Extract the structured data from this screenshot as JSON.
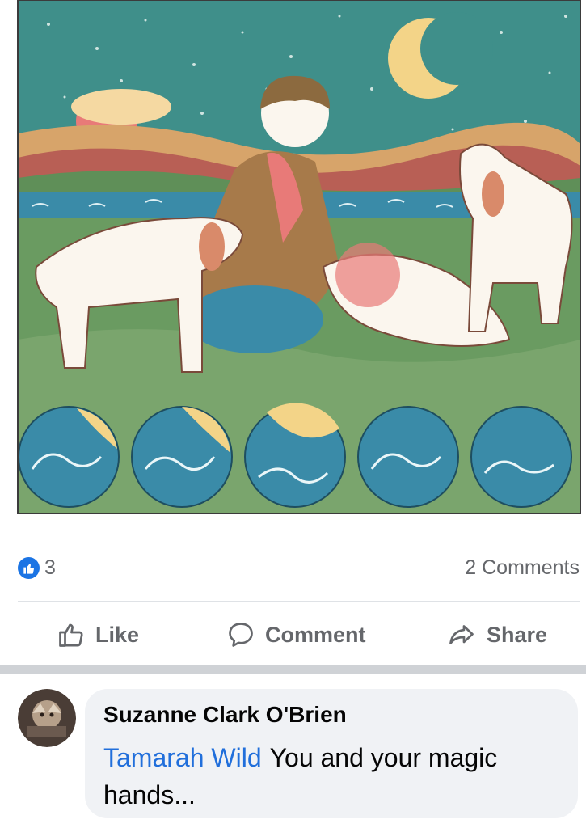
{
  "post": {
    "reactions": {
      "icon": "thumbs-up-icon",
      "count": "3"
    },
    "comments_count": "2 Comments"
  },
  "actions": {
    "like_label": "Like",
    "comment_label": "Comment",
    "share_label": "Share"
  },
  "comment": {
    "author": "Suzanne Clark O'Brien",
    "mention": "Tamarah Wild",
    "text": "You and your magic hands..."
  },
  "colors": {
    "accent": "#1b74e4",
    "mention": "#216fdb",
    "muted_text": "#65676b",
    "bubble_bg": "#f0f2f5"
  }
}
